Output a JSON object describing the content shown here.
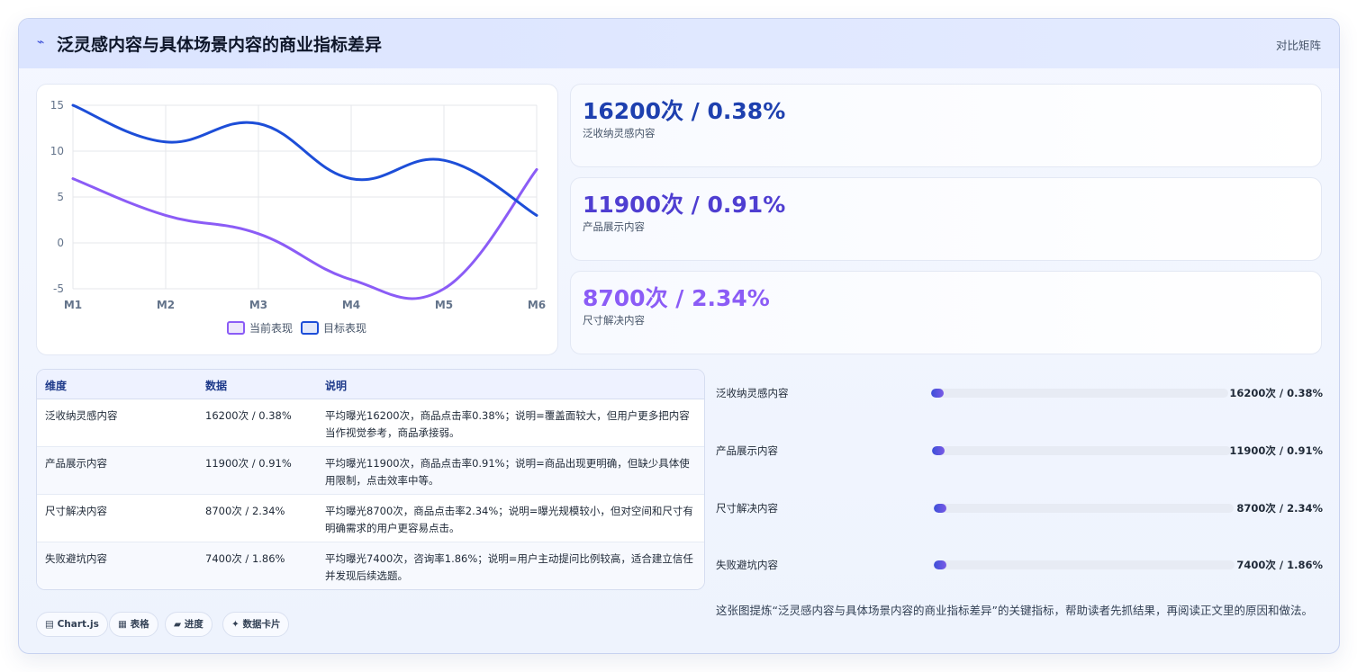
{
  "header": {
    "icon": "⌁",
    "title": "泛灵感内容与具体场景内容的商业指标差异",
    "tag": "对比矩阵"
  },
  "chart_data": {
    "type": "line",
    "categories": [
      "M1",
      "M2",
      "M3",
      "M4",
      "M5",
      "M6"
    ],
    "series": [
      {
        "name": "当前表现",
        "values": [
          7,
          3,
          1,
          -4,
          -5,
          8
        ],
        "color": "#8b5cf6"
      },
      {
        "name": "目标表现",
        "values": [
          15,
          11,
          13,
          7,
          9,
          3
        ],
        "color": "#1d4ed8"
      }
    ],
    "ylim": [
      -5,
      15
    ],
    "yticks": [
      15,
      10,
      5,
      0,
      -5
    ],
    "grid": true,
    "legend": "bottom"
  },
  "stats": [
    {
      "value": "16200次 / 0.38%",
      "label": "泛收纳灵感内容",
      "color": "#1e40af"
    },
    {
      "value": "11900次 / 0.91%",
      "label": "产品展示内容",
      "color": "#4f3ed1"
    },
    {
      "value": "8700次 / 2.34%",
      "label": "尺寸解决内容",
      "color": "#8b5cf6"
    }
  ],
  "table": {
    "headers": [
      "维度",
      "数据",
      "说明"
    ],
    "rows": [
      {
        "dim": "泛收纳灵感内容",
        "data": "16200次 / 0.38%",
        "desc": "平均曝光16200次，商品点击率0.38%；说明=覆盖面较大，但用户更多把内容当作视觉参考，商品承接弱。"
      },
      {
        "dim": "产品展示内容",
        "data": "11900次 / 0.91%",
        "desc": "平均曝光11900次，商品点击率0.91%；说明=商品出现更明确，但缺少具体使用限制，点击效率中等。"
      },
      {
        "dim": "尺寸解决内容",
        "data": "8700次 / 2.34%",
        "desc": "平均曝光8700次，商品点击率2.34%；说明=曝光规模较小，但对空间和尺寸有明确需求的用户更容易点击。"
      },
      {
        "dim": "失败避坑内容",
        "data": "7400次 / 1.86%",
        "desc": "平均曝光7400次，咨询率1.86%；说明=用户主动提问比例较高，适合建立信任并发现后续选题。"
      }
    ]
  },
  "chips": [
    "▤ Chart.js",
    "▦ 表格",
    "▰ 进度",
    "✦ 数据卡片"
  ],
  "bars": [
    {
      "label": "泛收纳灵感内容",
      "value": "16200次 / 0.38%",
      "fraction": 0.04
    },
    {
      "label": "产品展示内容",
      "value": "11900次 / 0.91%",
      "fraction": 0.04
    },
    {
      "label": "尺寸解决内容",
      "value": "8700次 / 2.34%",
      "fraction": 0.04
    },
    {
      "label": "失败避坑内容",
      "value": "7400次 / 1.86%",
      "fraction": 0.04
    }
  ],
  "note": "这张图提炼“泛灵感内容与具体场景内容的商业指标差异”的关键指标，帮助读者先抓结果，再阅读正文里的原因和做法。"
}
